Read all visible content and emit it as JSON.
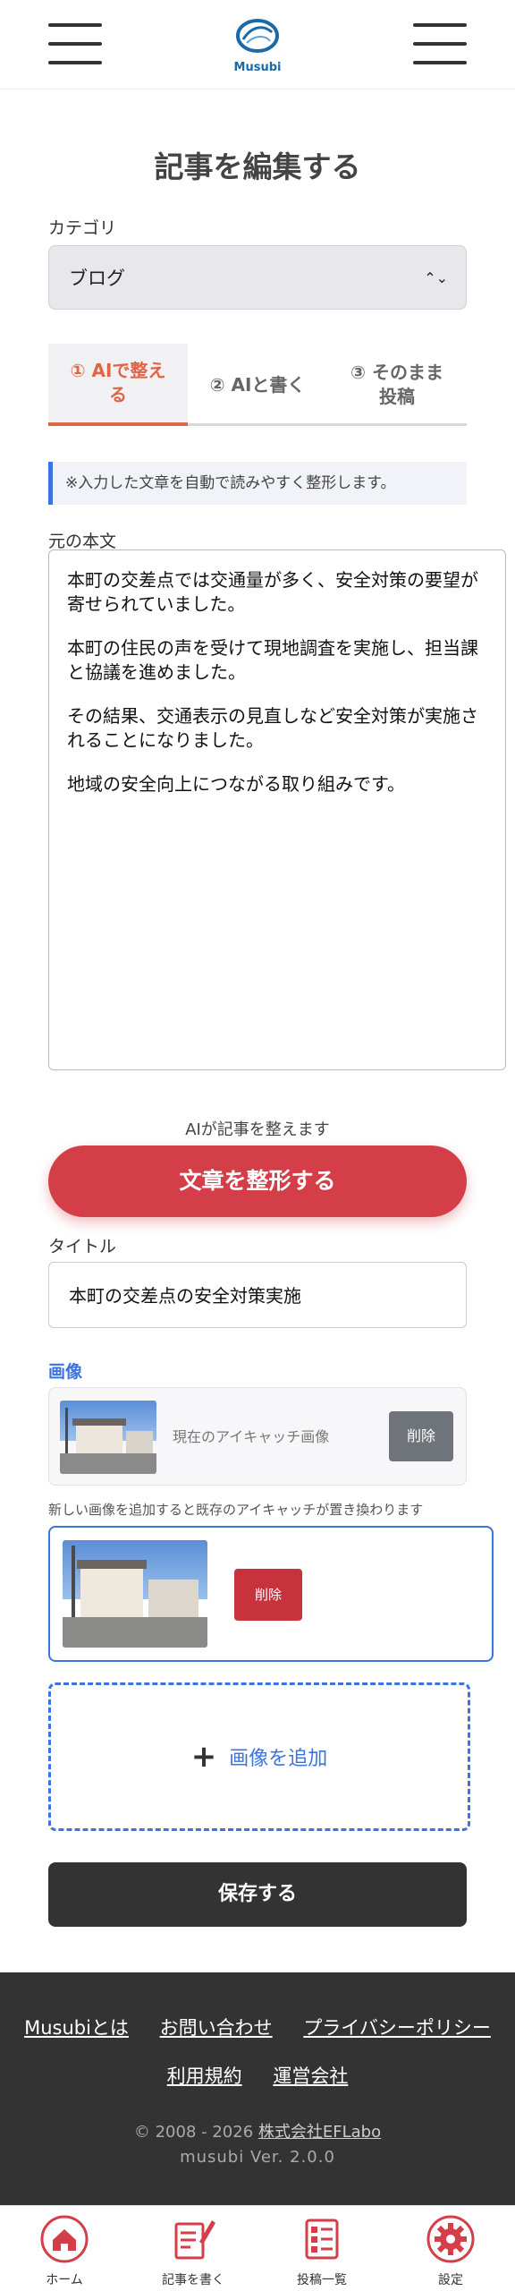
{
  "header": {
    "logo_text": "Musubi"
  },
  "page": {
    "title": "記事を編集する"
  },
  "category": {
    "label": "カテゴリ",
    "selected": "ブログ"
  },
  "tabs": [
    {
      "label_line1": "① AIで整え",
      "label_line2": "る",
      "active": true
    },
    {
      "label_line1": "② AIと書く",
      "label_line2": "",
      "active": false
    },
    {
      "label_line1": "③ そのまま",
      "label_line2": "投稿",
      "active": false
    }
  ],
  "notice": "※入力した文章を自動で読みやすく整形します。",
  "original_text": {
    "label": "元の本文",
    "paragraphs": [
      "本町の交差点では交通量が多く、安全対策の要望が寄せられていました。",
      "本町の住民の声を受けて現地調査を実施し、担当課と協議を進めました。",
      "その結果、交通表示の見直しなど安全対策が実施されることになりました。",
      "地域の安全向上につながる取り組みです。"
    ]
  },
  "ai_hint": "AIが記事を整えます",
  "format_button": "文章を整形する",
  "title_field": {
    "label": "タイトル",
    "value": "本町の交差点の安全対策実施"
  },
  "image": {
    "label": "画像",
    "current_text": "現在のアイキャッチ画像",
    "delete_label": "削除",
    "replace_note": "新しい画像を追加すると既存のアイキャッチが置き換わります",
    "new_delete_label": "削除",
    "add_label": "画像を追加"
  },
  "save_button": "保存する",
  "footer": {
    "links_row1": [
      "Musubiとは",
      "お問い合わせ",
      "プライバシーポリシー"
    ],
    "links_row2": [
      "利用規約",
      "運営会社"
    ],
    "copyright_prefix": "© 2008 - 2026 ",
    "company": "株式会社EFLabo",
    "version": "musubi Ver. 2.0.0"
  },
  "bottom_nav": [
    {
      "label": "ホーム",
      "icon": "home-icon"
    },
    {
      "label": "記事を書く",
      "icon": "write-icon"
    },
    {
      "label": "投稿一覧",
      "icon": "list-icon"
    },
    {
      "label": "設定",
      "icon": "gear-icon"
    }
  ],
  "colors": {
    "accent_red": "#d43e48",
    "tab_active": "#e0644a",
    "link_blue": "#3b73e0",
    "dark": "#333333"
  }
}
